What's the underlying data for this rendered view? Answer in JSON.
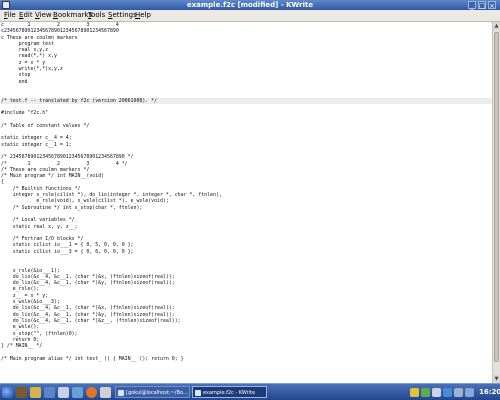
{
  "window": {
    "title": "example.f2c [modified] - KWrite"
  },
  "menubar": {
    "items": [
      {
        "mnemonic": "F",
        "rest": "ile"
      },
      {
        "mnemonic": "E",
        "rest": "dit"
      },
      {
        "mnemonic": "V",
        "rest": "iew"
      },
      {
        "mnemonic": "B",
        "rest": "ookmarks"
      },
      {
        "mnemonic": "T",
        "rest": "ools"
      },
      {
        "mnemonic": "S",
        "rest": "ettings"
      },
      {
        "mnemonic": "H",
        "rest": "elp"
      }
    ]
  },
  "editor": {
    "lines": [
      "c        1         2         3         4",
      "c234567890123456789012345678901234567890",
      "c These are coulmn markers",
      "      program test",
      "      real x,y,z",
      "      read(*,*) x,y",
      "      z = x * y",
      "      write(*,*)x,y,z",
      "      stop",
      "      end",
      "",
      "",
      "/* test.f -- translated by f2c (version 20061008). */",
      "",
      "#include \"f2c.h\"",
      "",
      "/* Table of constant values */",
      "",
      "static integer c__4 = 4;",
      "static integer c__1 = 1;",
      "",
      "/* 234567890123456789012345678901234567890 */",
      "/*       1         2         3         4 */",
      "/* These are coulmn markers */",
      "/* Main program */ int MAIN__(void)",
      "{",
      "    /* Builtin functions */",
      "    integer s_rsle(cilist *), do_lio(integer *, integer *, char *, ftnlen),",
      "            e_rsle(void), s_wsle(cilist *), e_wsle(void);",
      "    /* Subroutine */ int s_stop(char *, ftnlen);",
      "",
      "    /* Local variables */",
      "    static real x, y, z__;",
      "",
      "    /* Fortran I/O blocks */",
      "    static cilist io___1 = { 0, 5, 0, 0, 0 };",
      "    static cilist io___3 = { 0, 6, 0, 0, 0 };",
      "",
      "",
      "    s_rsle(&io___1);",
      "    do_lio(&c__4, &c__1, (char *)&x, (ftnlen)sizeof(real));",
      "    do_lio(&c__4, &c__1, (char *)&y, (ftnlen)sizeof(real));",
      "    e_rsle();",
      "    z__ = x * y;",
      "    s_wsle(&io___3);",
      "    do_lio(&c__4, &c__1, (char *)&x, (ftnlen)sizeof(real));",
      "    do_lio(&c__4, &c__1, (char *)&y, (ftnlen)sizeof(real));",
      "    do_lio(&c__4, &c__1, (char *)&z__, (ftnlen)sizeof(real));",
      "    e_wsle();",
      "    s_stop(\"\", (ftnlen)0);",
      "    return 0;",
      "} /* MAIN__ */",
      "",
      "/* Main program alias */ int test_ () { MAIN__ (); return 0; }"
    ],
    "highlighted_line_index": 12
  },
  "taskbar": {
    "tasks": [
      {
        "label": "[gokul@localhost:~/Bo..."
      },
      {
        "label": "example.f2c - KWrite"
      }
    ],
    "clock": "16:20",
    "colors": {
      "accent": "#2f5aa6"
    }
  }
}
